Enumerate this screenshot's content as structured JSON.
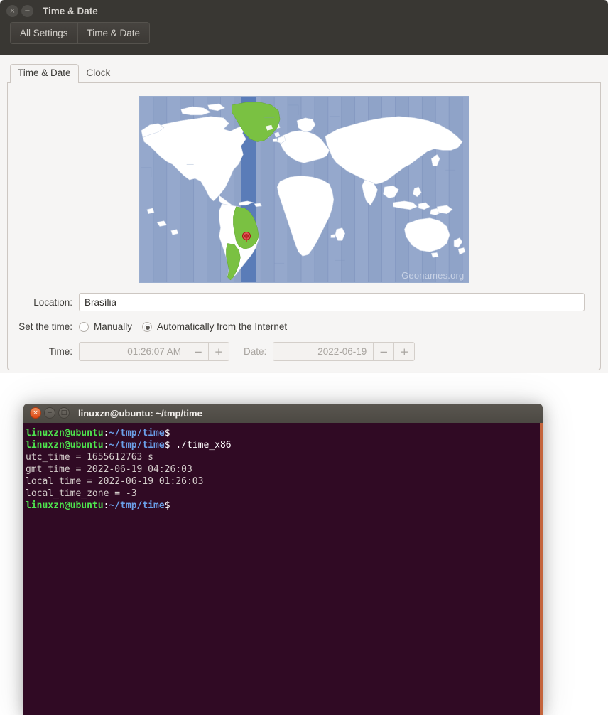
{
  "settings_window": {
    "title": "Time & Date",
    "window_buttons": [
      {
        "name": "close",
        "glyph": "×",
        "active": false
      },
      {
        "name": "minimize",
        "glyph": "−",
        "active": false
      }
    ],
    "toolbar": {
      "all_settings_label": "All Settings",
      "current_panel_label": "Time & Date"
    },
    "tabs": [
      {
        "label": "Time & Date",
        "active": true
      },
      {
        "label": "Clock",
        "active": false
      }
    ],
    "map": {
      "attribution": "Geonames.org",
      "ocean_color": "#8fa3c8",
      "land_color": "#ffffff",
      "highlight_country_color": "#7ac142",
      "highlight_zone_color": "#5a7cb8",
      "pin_color": "#d92b2b",
      "selected_zone": "UTC-3"
    },
    "location": {
      "label": "Location:",
      "value": "Brasília",
      "placeholder": ""
    },
    "set_time": {
      "label": "Set the time:",
      "options": [
        {
          "label": "Manually",
          "selected": false
        },
        {
          "label": "Automatically from the Internet",
          "selected": true
        }
      ]
    },
    "time_field": {
      "label": "Time:",
      "value": "01:26:07 AM",
      "decrement": "−",
      "increment": "+",
      "disabled": true
    },
    "date_field": {
      "label": "Date:",
      "value": "2022-06-19",
      "decrement": "−",
      "increment": "+",
      "disabled": true
    }
  },
  "terminal_window": {
    "title": "linuxzn@ubuntu: ~/tmp/time",
    "window_buttons": [
      {
        "name": "close",
        "glyph": "×",
        "active": true
      },
      {
        "name": "minimize",
        "glyph": "−",
        "active": false
      },
      {
        "name": "maximize",
        "glyph": "□",
        "active": false
      }
    ],
    "background_color": "#300a24",
    "prompt": {
      "user_host": "linuxzn@ubuntu",
      "separator": ":",
      "path": "~/tmp/time",
      "symbol": "$"
    },
    "lines": [
      {
        "type": "prompt",
        "command": ""
      },
      {
        "type": "prompt",
        "command": " ./time_x86"
      },
      {
        "type": "output",
        "text": "utc_time = 1655612763 s"
      },
      {
        "type": "output",
        "text": "gmt time = 2022-06-19 04:26:03"
      },
      {
        "type": "output",
        "text": "local time = 2022-06-19 01:26:03"
      },
      {
        "type": "output",
        "text": "local_time_zone = -3"
      },
      {
        "type": "prompt",
        "command": ""
      }
    ]
  }
}
